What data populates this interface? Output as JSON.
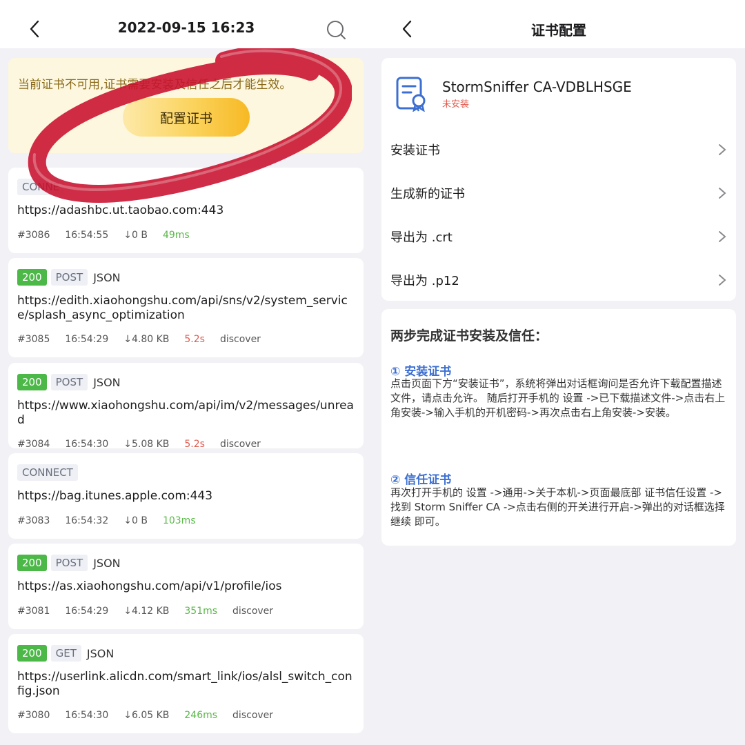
{
  "left": {
    "nav": {
      "title": "2022-09-15 16:23",
      "back_icon": "chevron-left-icon",
      "search_icon": "search-icon"
    },
    "warning": {
      "text": "当前证书不可用,证书需要安装及信任之后才能生效。",
      "button": "配置证书"
    },
    "requests": [
      {
        "status": "",
        "method": "CONNE",
        "type": "",
        "url": "https://adashbc.ut.taobao.com:443",
        "id": "#3086",
        "time": "16:54:55",
        "size": "↓0 B",
        "duration": "49ms",
        "duration_color": "green",
        "tag": ""
      },
      {
        "status": "200",
        "method": "POST",
        "type": "JSON",
        "url": "https://edith.xiaohongshu.com/api/sns/v2/system_service/splash_async_optimization",
        "id": "#3085",
        "time": "16:54:29",
        "size": "↓4.80 KB",
        "duration": "5.2s",
        "duration_color": "red",
        "tag": "discover"
      },
      {
        "status": "200",
        "method": "POST",
        "type": "JSON",
        "url": "https://www.xiaohongshu.com/api/im/v2/messages/unread",
        "id": "#3084",
        "time": "16:54:30",
        "size": "↓5.08 KB",
        "duration": "5.2s",
        "duration_color": "red",
        "tag": "discover"
      },
      {
        "status": "",
        "method": "CONNECT",
        "type": "",
        "url": "https://bag.itunes.apple.com:443",
        "id": "#3083",
        "time": "16:54:32",
        "size": "↓0 B",
        "duration": "103ms",
        "duration_color": "green",
        "tag": ""
      },
      {
        "status": "200",
        "method": "POST",
        "type": "JSON",
        "url": "https://as.xiaohongshu.com/api/v1/profile/ios",
        "id": "#3081",
        "time": "16:54:29",
        "size": "↓4.12 KB",
        "duration": "351ms",
        "duration_color": "green",
        "tag": "discover"
      },
      {
        "status": "200",
        "method": "GET",
        "type": "JSON",
        "url": "https://userlink.alicdn.com/smart_link/ios/alsl_switch_config.json",
        "id": "#3080",
        "time": "16:54:30",
        "size": "↓6.05 KB",
        "duration": "246ms",
        "duration_color": "green",
        "tag": "discover"
      }
    ]
  },
  "right": {
    "nav": {
      "title": "证书配置",
      "back_icon": "chevron-left-icon"
    },
    "cert": {
      "icon": "certificate-icon",
      "name": "StormSniffer CA-VDBLHSGE",
      "status": "未安装"
    },
    "menu": [
      "安装证书",
      "生成新的证书",
      "导出为 .crt",
      "导出为 .p12"
    ],
    "guide": {
      "title": "两步完成证书安装及信任：",
      "step1_title": "① 安装证书",
      "step1_body": "点击页面下方“安装证书”，系统将弹出对话框询问是否允许下载配置描述文件，请点击允许。 随后打开手机的 设置 ->已下载描述文件->点击右上角安装->输入手机的开机密码->再次点击右上角安装->安装。",
      "step2_title": "② 信任证书",
      "step2_body": "再次打开手机的 设置 ->通用->关于本机->页面最底部 证书信任设置 ->找到 Storm Sniffer CA ->点击右侧的开关进行开启->弹出的对话框选择 继续 即可。"
    }
  },
  "colors": {
    "accent": "#3c6fd1",
    "success": "#4cb847",
    "danger": "#e05b4e",
    "warning_bg": "#fdf7df",
    "marker": "#c8102e"
  }
}
